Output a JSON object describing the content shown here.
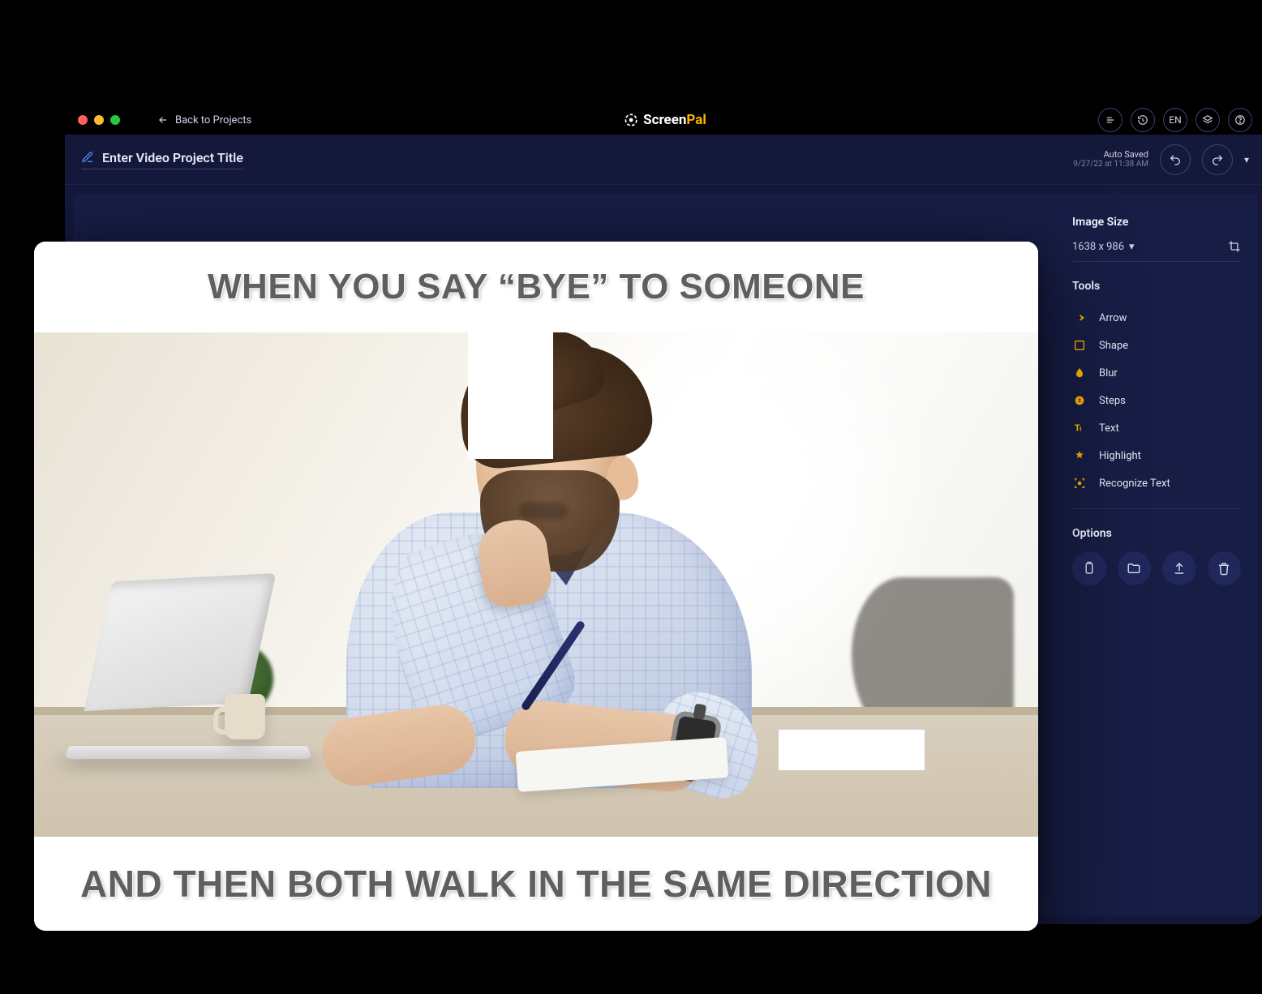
{
  "titlebar": {
    "back_label": "Back to  Projects",
    "brand_a": "Screen",
    "brand_b": "Pal",
    "lang": "EN"
  },
  "project": {
    "title_placeholder": "Enter Video Project Title",
    "autosave_label": "Auto Saved",
    "autosave_time": "9/27/22 at 11:38 AM"
  },
  "panel": {
    "image_size_heading": "Image Size",
    "image_size_value": "1638 x 986",
    "tools_heading": "Tools",
    "tools": [
      {
        "label": "Arrow"
      },
      {
        "label": "Shape"
      },
      {
        "label": "Blur"
      },
      {
        "label": "Steps"
      },
      {
        "label": "Text"
      },
      {
        "label": "Highlight"
      },
      {
        "label": "Recognize Text"
      }
    ],
    "options_heading": "Options"
  },
  "meme": {
    "top": "WHEN YOU SAY “BYE” TO SOMEONE",
    "bottom": "AND THEN BOTH WALK IN THE SAME DIRECTION"
  }
}
